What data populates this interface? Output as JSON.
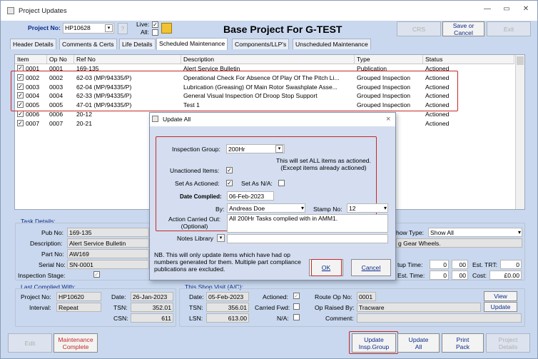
{
  "window": {
    "title": "Project Updates"
  },
  "header": {
    "project_no_label": "Project No:",
    "project_no": "HP10628",
    "help": "?",
    "live_label": "Live:",
    "all_label": "All:",
    "live": "✓",
    "project_title": "Base Project For G-TEST",
    "crs": "CRS",
    "save_or_cancel": "Save or\nCancel",
    "exit": "Exit"
  },
  "tabs": [
    "Header Details",
    "Comments & Certs",
    "Life Details",
    "Scheduled Maintenance",
    "Components/LLP's",
    "Unscheduled Maintenance"
  ],
  "grid": {
    "columns": [
      "Item",
      "Op No",
      "Ref No",
      "Description",
      "Type",
      "Status"
    ],
    "rows": [
      {
        "item": "0001",
        "op": "0001",
        "ref": "169-135",
        "desc": "Alert Service Bulletin",
        "type": "Publication",
        "status": "Actioned"
      },
      {
        "item": "0002",
        "op": "0002",
        "ref": "62-03 (MP/94335/P)",
        "desc": "Operational Check For Absence Of Play Of The Pitch Li...",
        "type": "Grouped Inspection",
        "status": "Actioned"
      },
      {
        "item": "0003",
        "op": "0003",
        "ref": "62-04 (MP/94335/P)",
        "desc": "Lubrication (Greasing) Of Main Rotor Swashplate Asse...",
        "type": "Grouped Inspection",
        "status": "Actioned"
      },
      {
        "item": "0004",
        "op": "0004",
        "ref": "62-33 (MP/94335/P)",
        "desc": "General Visual Inspection Of Droop Stop Support",
        "type": "Grouped Inspection",
        "status": "Actioned"
      },
      {
        "item": "0005",
        "op": "0005",
        "ref": "47-01 (MP/94335/P)",
        "desc": "Test 1",
        "type": "Grouped Inspection",
        "status": "Actioned"
      },
      {
        "item": "0006",
        "op": "0006",
        "ref": "20-12",
        "desc": "",
        "type": "",
        "status": "Actioned"
      },
      {
        "item": "0007",
        "op": "0007",
        "ref": "20-21",
        "desc": "",
        "type": "",
        "status": "Actioned"
      }
    ]
  },
  "task_details": {
    "section": "Task Details:",
    "pub_no_label": "Pub No:",
    "pub_no": "169-135",
    "description_label": "Description:",
    "description": "Alert Service Bulletin",
    "part_no_label": "Part No:",
    "part_no": "AW169",
    "serial_no_label": "Serial No:",
    "serial_no": "SN-0001",
    "inspection_stage_label": "Inspection Stage:",
    "inspection_stage": "✓",
    "show_type_label": "how Type:",
    "show_type": "Show All",
    "gear_text": "g Gear Wheels.",
    "setup_time_label": "tup Time:",
    "setup_h": "0",
    "setup_m": "00",
    "est_trt_label": "Est. TRT:",
    "est_trt": "0",
    "est_time_label": "Est. Time:",
    "est_h": "0",
    "est_m": "00",
    "cost_label": "Cost:",
    "cost": "£0.00"
  },
  "last_complied": {
    "section": "Last Complied With:",
    "project_no_label": "Project No:",
    "project_no": "HP10620",
    "date_label": "Date:",
    "date": "26-Jan-2023",
    "interval_label": "Interval:",
    "interval": "Repeat",
    "tsn_label": "TSN:",
    "tsn": "352.01",
    "csn_label": "CSN:",
    "csn": "611"
  },
  "shop_visit": {
    "section": "This Shop Visit (A/C):",
    "date_label": "Date:",
    "date": "05-Feb-2023",
    "tsn_label": "TSN:",
    "tsn": "356.01",
    "lsn_label": "LSN:",
    "lsn": "613.00",
    "actioned_label": "Actioned:",
    "actioned": "✓",
    "carried_fwd_label": "Carried Fwd:",
    "na_label": "N/A:",
    "route_op_label": "Route Op No:",
    "route_op": "0001",
    "op_raised_label": "Op Raised By:",
    "op_raised": "Tracware",
    "comment_label": "Comment:",
    "view": "View",
    "update": "Update"
  },
  "footer": {
    "edit": "Edit",
    "maintenance_complete": "Maintenance\nComplete",
    "update_insp_group": "Update\nInsp.Group",
    "update_all": "Update\nAll",
    "print_pack": "Print\nPack",
    "project_details": "Project\nDetails"
  },
  "dialog": {
    "title": "Update All",
    "close": "×",
    "inspection_group_label": "Inspection Group:",
    "inspection_group": "200Hr",
    "info": "This will set ALL items as actioned.\n(Except items already actioned)",
    "unactioned_label": "Unactioned Items:",
    "unactioned": "✓",
    "set_actioned_label": "Set As Actioned:",
    "set_actioned": "✓",
    "set_na_label": "Set As N/A:",
    "date_complied_label": "Date Complied:",
    "date_complied": "06-Feb-2023",
    "by_label": "By:",
    "by": "Andreas Doe",
    "stamp_no_label": "Stamp No:",
    "stamp_no": "12",
    "action_label": "Action Carried Out:\n(Optional)",
    "action": "All 200Hr Tasks complied with in AMM1.",
    "notes_library_label": "Notes Library",
    "notes_arrow": "▾",
    "note": "NB. This will only update items which have had op numbers generated for them. Multiple part compliance publications are excluded.",
    "ok": "OK",
    "cancel": "Cancel"
  },
  "colors": {
    "highlight": "#c62828",
    "background": "#c9d8ee",
    "link": "#0a2a8a"
  }
}
